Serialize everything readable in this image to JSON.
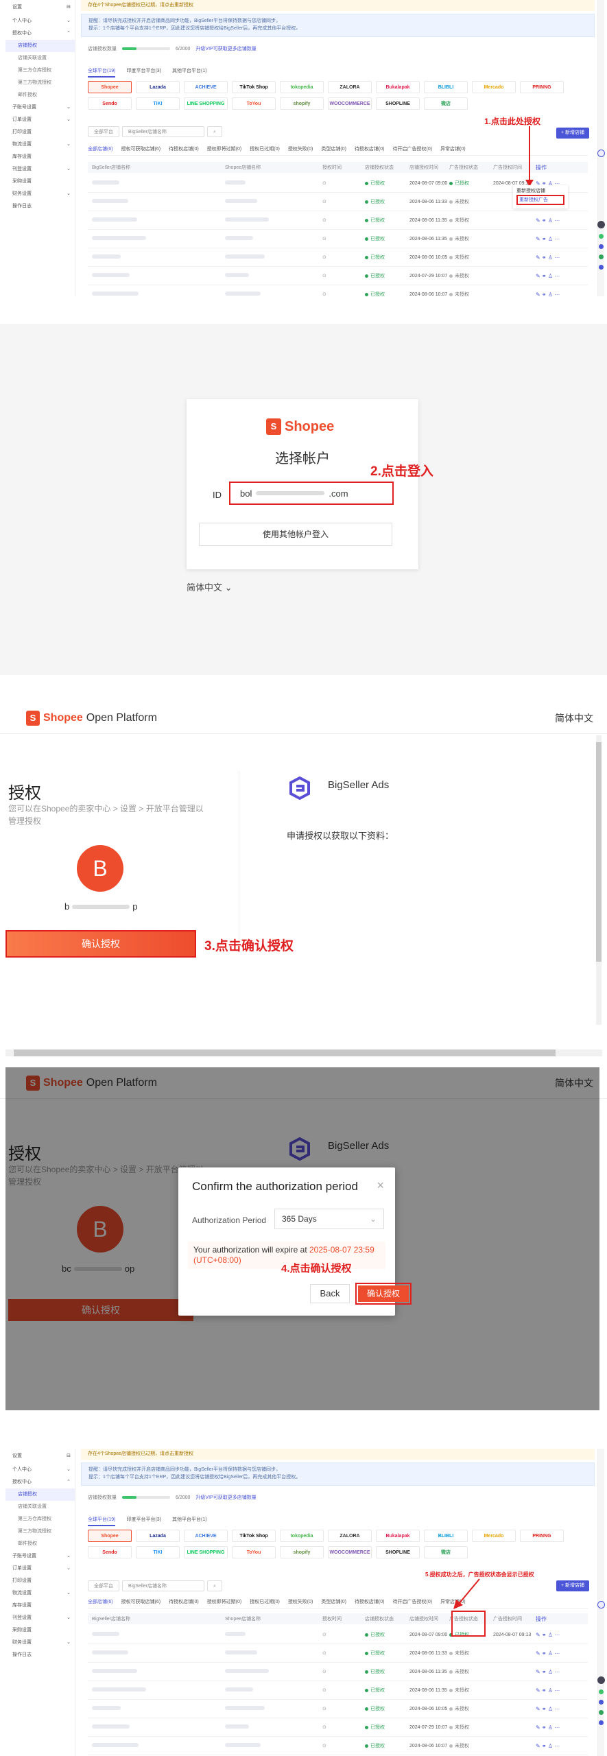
{
  "admin": {
    "sidebar": {
      "top_label": "设置",
      "items": [
        {
          "label": "个人中心",
          "kind": "group",
          "caret": "⌄"
        },
        {
          "label": "授权中心",
          "kind": "group-open",
          "caret": "⌃"
        },
        {
          "label": "店铺授权",
          "kind": "active"
        },
        {
          "label": "店铺关联设置",
          "kind": "sub"
        },
        {
          "label": "第三方仓库授权",
          "kind": "sub"
        },
        {
          "label": "第三方物流授权",
          "kind": "sub"
        },
        {
          "label": "邮件授权",
          "kind": "sub"
        },
        {
          "label": "子账号设置",
          "kind": "group",
          "caret": "⌄"
        },
        {
          "label": "订单设置",
          "kind": "group",
          "caret": "⌄"
        },
        {
          "label": "打印设置",
          "kind": "group",
          "caret": ""
        },
        {
          "label": "物流设置",
          "kind": "group",
          "caret": "⌄"
        },
        {
          "label": "库存设置",
          "kind": "group",
          "caret": ""
        },
        {
          "label": "刊登设置",
          "kind": "group",
          "caret": "⌄"
        },
        {
          "label": "采购设置",
          "kind": "group",
          "caret": ""
        },
        {
          "label": "财务设置",
          "kind": "group",
          "caret": "⌄"
        },
        {
          "label": "操作日志",
          "kind": "group",
          "caret": ""
        }
      ]
    },
    "notice": "存在4个Shopee店铺授权已过期，请点击重新授权",
    "info_lines": [
      "提醒：请尽快完成授权并开启店铺商品同步功能，BigSeller平台将保持数据与您店铺同步。",
      "提示：1个店铺每个平台支持1个ERP，因此建议您将店铺授权给BigSeller后，再完成其他平台授权。"
    ],
    "quota": {
      "label": "店铺授权数量",
      "value": "6/2000",
      "link": "升级VIP可获取更多店铺数量",
      "fill": 0.3
    },
    "platform_tabs": [
      "全球平台(19)",
      "印度平台平台(3)",
      "其他平台平台(1)"
    ],
    "logos": [
      {
        "name": "Shopee",
        "color": "#ee4d2d",
        "selected": true
      },
      {
        "name": "Lazada",
        "color": "#1a2b8c"
      },
      {
        "name": "ACHIEVE",
        "color": "#3c7ae0"
      },
      {
        "name": "TikTok Shop",
        "color": "#111"
      },
      {
        "name": "tokopedia",
        "color": "#42b549"
      },
      {
        "name": "ZALORA",
        "color": "#333"
      },
      {
        "name": "Bukalapak",
        "color": "#e31e52"
      },
      {
        "name": "BLIBLI",
        "color": "#0095da"
      },
      {
        "name": "Mercado",
        "color": "#e8a400"
      },
      {
        "name": "PRINNG",
        "color": "#e02020"
      },
      {
        "name": "Sendo",
        "color": "#e02020"
      },
      {
        "name": "TIKI",
        "color": "#1a94ff"
      },
      {
        "name": "LINE SHOPPING",
        "color": "#06c755"
      },
      {
        "name": "ToYou",
        "color": "#ee4d2d"
      },
      {
        "name": "shopify",
        "color": "#5e8e3e"
      },
      {
        "name": "WOOCOMMERCE",
        "color": "#7f54b3"
      },
      {
        "name": "SHOPLINE",
        "color": "#222"
      },
      {
        "name": "微店",
        "color": "#2fa45a"
      }
    ],
    "filter": {
      "select": "全部平台",
      "input": "BigSeller店铺名称",
      "search": "搜索"
    },
    "add_button": "+ 新增店铺",
    "status_tabs": [
      "全部店铺(6)",
      "授权可获取店铺(6)",
      "待授权店铺(0)",
      "授权即将过期(0)",
      "授权已过期(0)",
      "授权失败(0)",
      "类型店铺(0)",
      "待授权店铺(0)",
      "待开启广告授权(0)",
      "异常店铺(0)"
    ],
    "columns": [
      "BigSeller店铺名称",
      "Shopee店铺名称",
      "授权时间",
      "店铺授权状态",
      "店铺授权时间",
      "广告授权状态",
      "广告授权时间",
      "操作"
    ],
    "rows": [
      {
        "status": "已授权",
        "date": "2024-08-07 09:00",
        "ad": "已授权",
        "ad_date": "2024-08-07 09:13",
        "ops": "✎ ⚭ ♙ ···"
      },
      {
        "status": "已授权",
        "date": "2024-08-06 11:33",
        "ad": "未授权",
        "ad_date": "",
        "ops": "✎ ⚭ ♙ ···"
      },
      {
        "status": "已授权",
        "date": "2024-08-06 11:35",
        "ad": "未授权",
        "ad_date": "",
        "ops": "✎ ⚭ ♙ ···"
      },
      {
        "status": "已授权",
        "date": "2024-08-06 11:35",
        "ad": "未授权",
        "ad_date": "",
        "ops": "✎ ⚭ ♙ ···"
      },
      {
        "status": "已授权",
        "date": "2024-08-06 10:05",
        "ad": "未授权",
        "ad_date": "",
        "ops": "✎ ⚭ ♙ ···"
      },
      {
        "status": "已授权",
        "date": "2024-07-29 10:07",
        "ad": "未授权",
        "ad_date": "",
        "ops": "✎ ⚭ ♙ ···"
      },
      {
        "status": "已授权",
        "date": "2024-08-06 10:07",
        "ad": "未授权",
        "ad_date": "",
        "ops": "✎ ⚭ ♙ ···"
      }
    ],
    "step1_label": "1.点击此处授权",
    "step1_popup": {
      "item1": "重新授权店铺",
      "item2": "重新授权广告"
    },
    "step5_label": "5.授权成功之后，广告授权状态会显示已授权"
  },
  "login": {
    "brand": "Shopee",
    "title": "选择帐户",
    "id_label": "ID",
    "account_prefix": "bol",
    "account_suffix": ".com",
    "other_login": "使用其他帐户登入",
    "language": "简体中文",
    "step2_label": "2.点击登入"
  },
  "open_platform": {
    "brand": "Shopee",
    "platform": "Open Platform",
    "lang": "简体中文",
    "title": "授权",
    "desc": "您可以在Shopee的卖家中心 > 设置 > 开放平台管理以管理授权",
    "avatar_letter": "B",
    "account_prefix": "b",
    "account_suffix": "p",
    "confirm_button": "确认授权",
    "app_name": "BigSeller Ads",
    "request_text": "申请授权以获取以下资料：",
    "step3_label": "3.点击确认授权"
  },
  "modal": {
    "account_prefix": "bc",
    "account_suffix": "op",
    "title": "Confirm the authorization period",
    "period_label": "Authorization Period",
    "period_value": "365 Days",
    "expire_text": "Your authorization will expire at",
    "expire_date": "2025-08-07 23:59",
    "expire_tz": "(UTC+08:00)",
    "back": "Back",
    "confirm": "确认授权",
    "step4_label": "4.点击确认授权"
  }
}
